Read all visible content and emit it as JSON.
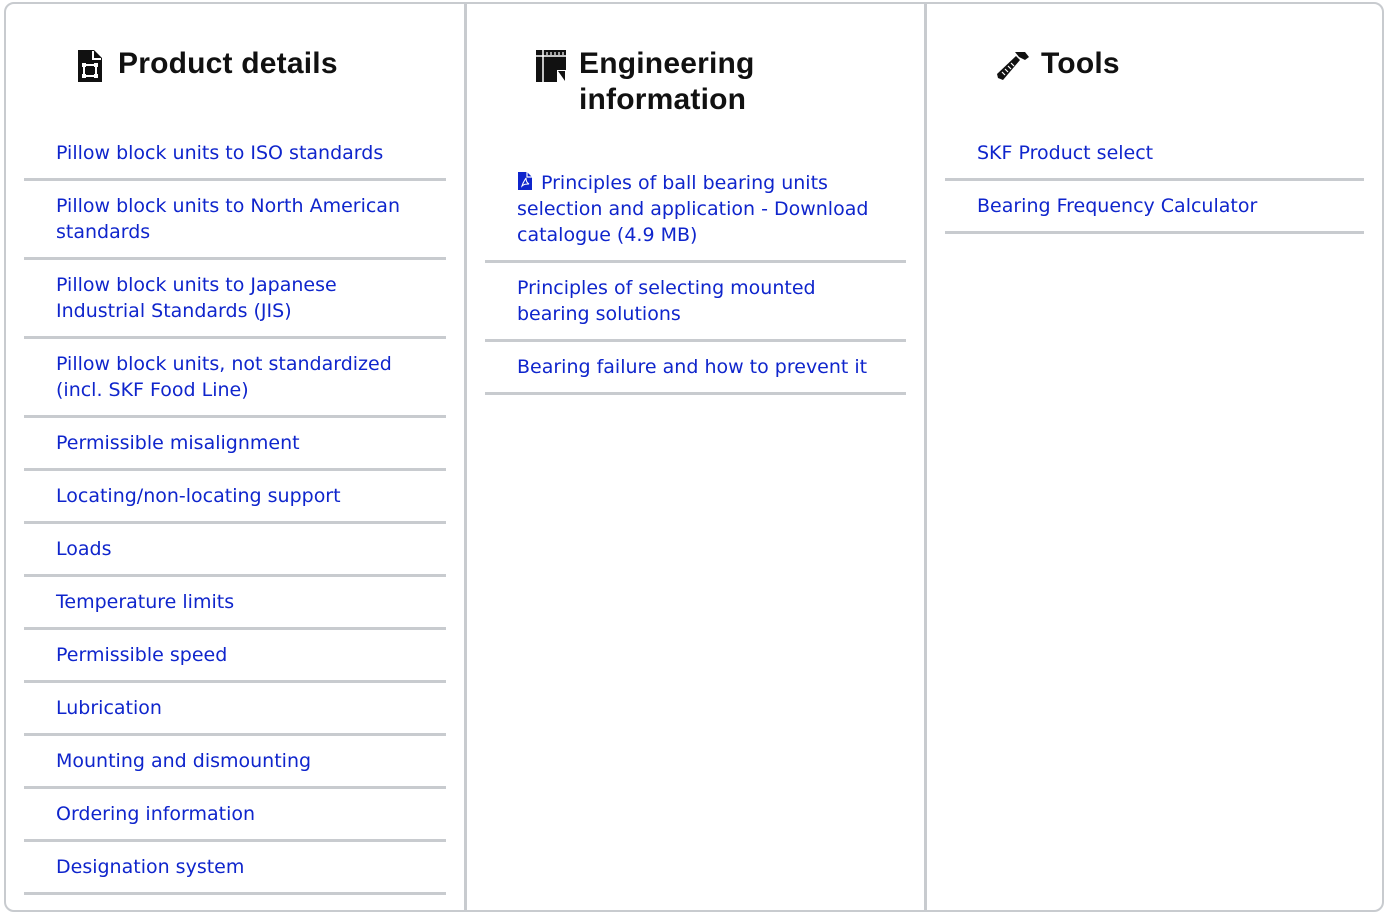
{
  "product_details": {
    "title": "Product details",
    "icon": "document-icon",
    "links": [
      "Pillow block units to ISO standards",
      "Pillow block units to North American standards",
      "Pillow block units to Japanese Industrial Standards (JIS)",
      "Pillow block units, not standardized (incl. SKF Food Line)",
      "Permissible misalignment",
      "Locating/non-locating support",
      "Loads",
      "Temperature limits",
      "Permissible speed",
      "Lubrication",
      "Mounting and dismounting",
      "Ordering information",
      "Designation system"
    ]
  },
  "engineering_information": {
    "title": "Engineering information",
    "icon": "book-icon",
    "links": [
      "Principles of ball bearing units selection and application - Download catalogue (4.9 MB)",
      "Principles of selecting mounted bearing solutions",
      "Bearing failure and how to prevent it"
    ],
    "first_link_icon": "pdf-icon"
  },
  "tools": {
    "title": "Tools",
    "icon": "hammer-icon",
    "links": [
      "SKF Product select",
      "Bearing Frequency Calculator"
    ]
  },
  "colors": {
    "link": "#0f25cc",
    "divider": "#c8cbcf",
    "heading": "#111111"
  }
}
